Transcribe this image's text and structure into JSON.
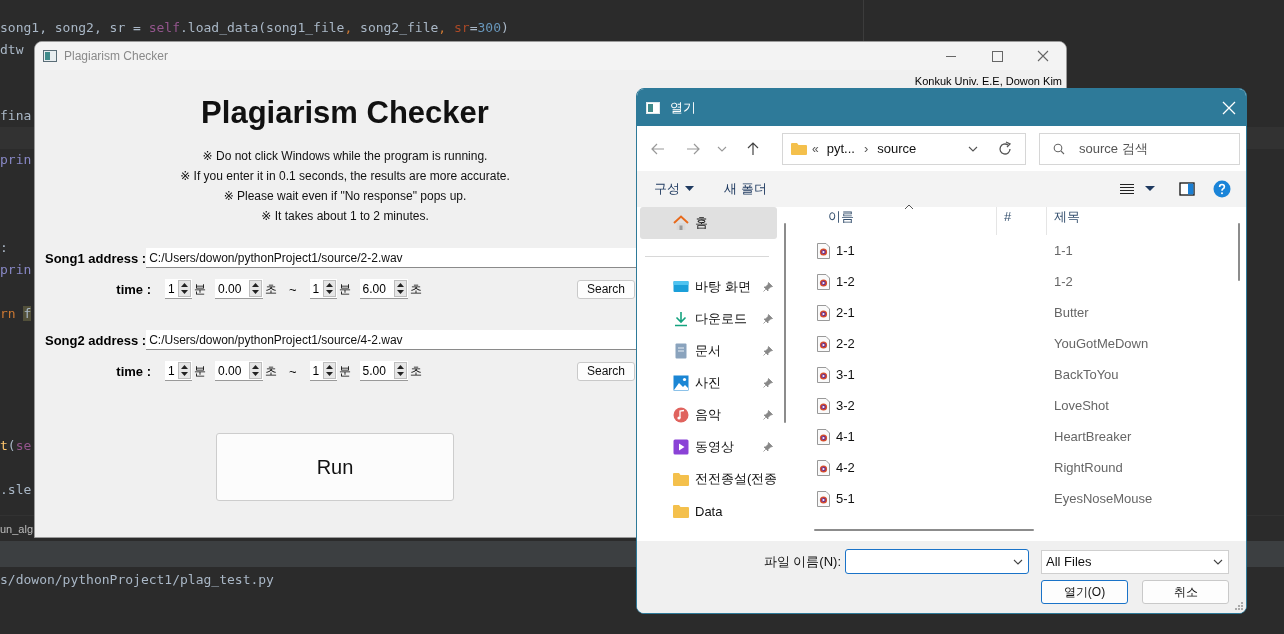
{
  "ide": {
    "code_lines": [
      {
        "tokens": [
          {
            "text": "song1, song2, sr = ",
            "kind": "plain"
          },
          {
            "text": "self",
            "kind": "self"
          },
          {
            "text": ".load_data(song1_file",
            "kind": "plain"
          },
          {
            "text": ", ",
            "kind": "punct"
          },
          {
            "text": "song2_file",
            "kind": "plain"
          },
          {
            "text": ", ",
            "kind": "punct"
          },
          {
            "text": "sr",
            "kind": "param"
          },
          {
            "text": "=",
            "kind": "plain"
          },
          {
            "text": "300",
            "kind": "number"
          },
          {
            "text": ")",
            "kind": "plain"
          }
        ]
      },
      {
        "tokens": [
          {
            "text": "dtw",
            "kind": "plain"
          }
        ]
      },
      {
        "tokens": [
          {
            "text": "fina",
            "kind": "plain"
          }
        ]
      },
      {
        "tokens": [
          {
            "text": "prin",
            "kind": "builtin"
          }
        ]
      },
      {
        "tokens": [
          {
            "text": ":",
            "kind": "plain"
          }
        ]
      },
      {
        "tokens": [
          {
            "text": "prin",
            "kind": "builtin"
          }
        ]
      },
      {
        "tokens": [
          {
            "text": "rn ",
            "kind": "keyword"
          },
          {
            "text": "f",
            "kind": "match"
          }
        ]
      },
      {
        "tokens": [
          {
            "text": "t",
            "kind": "function"
          },
          {
            "text": "(",
            "kind": "plain"
          },
          {
            "text": "se",
            "kind": "self"
          }
        ]
      },
      {
        "tokens": [
          {
            "text": ".sle",
            "kind": "plain"
          }
        ]
      }
    ],
    "current_line_highlight": true,
    "run_tab": "un_alg",
    "console_line": "s/dowon/pythonProject1/plag_test.py"
  },
  "app_window": {
    "title": "Plagiarism Checker",
    "credit": "Konkuk Univ. E.E, Dowon Kim",
    "heading": "Plagiarism Checker",
    "notes": [
      "※ Do not click Windows while the program is running.",
      "※ If you enter it in 0.1 seconds, the results are more accurate.",
      "※ Please wait even if \"No response\" pops up.",
      "※ It takes about 1 to 2 minutes."
    ],
    "songs": [
      {
        "label": "Song1 address :",
        "path": "C:/Users/dowon/pythonProject1/source/2-2.wav",
        "time_label": "time :",
        "start": [
          {
            "value": "1",
            "unit": "분"
          },
          {
            "value": "0.00",
            "unit": "초"
          }
        ],
        "separator": "~",
        "end": [
          {
            "value": "1",
            "unit": "분"
          },
          {
            "value": "6.00",
            "unit": "초"
          }
        ],
        "search_button": "Search"
      },
      {
        "label": "Song2 address :",
        "path": "C:/Users/dowon/pythonProject1/source/4-2.wav",
        "time_label": "time :",
        "start": [
          {
            "value": "1",
            "unit": "분"
          },
          {
            "value": "0.00",
            "unit": "초"
          }
        ],
        "separator": "~",
        "end": [
          {
            "value": "1",
            "unit": "분"
          },
          {
            "value": "5.00",
            "unit": "초"
          }
        ],
        "search_button": "Search"
      }
    ],
    "run_button": "Run"
  },
  "file_dialog": {
    "title": "열기",
    "address": {
      "overflow": "«",
      "parent": "pyt...",
      "separator": "›",
      "current": "source"
    },
    "search_placeholder": "source 검색",
    "organize": "구성",
    "new_folder": "새 폴더",
    "nav_items": [
      {
        "label": "홈",
        "kind": "home",
        "pinned": false,
        "selected": true
      },
      {
        "label": "바탕 화면",
        "kind": "desktop",
        "pinned": true,
        "selected": false
      },
      {
        "label": "다운로드",
        "kind": "download",
        "pinned": true,
        "selected": false
      },
      {
        "label": "문서",
        "kind": "document",
        "pinned": true,
        "selected": false
      },
      {
        "label": "사진",
        "kind": "picture",
        "pinned": true,
        "selected": false
      },
      {
        "label": "음악",
        "kind": "music",
        "pinned": true,
        "selected": false
      },
      {
        "label": "동영상",
        "kind": "video",
        "pinned": true,
        "selected": false
      },
      {
        "label": "전전종설(전종",
        "kind": "folder",
        "pinned": false,
        "selected": false
      },
      {
        "label": "Data",
        "kind": "folder",
        "pinned": false,
        "selected": false
      }
    ],
    "columns": [
      "이름",
      "#",
      "제목"
    ],
    "files": [
      {
        "name": "1-1",
        "title": "1-1"
      },
      {
        "name": "1-2",
        "title": "1-2"
      },
      {
        "name": "2-1",
        "title": "Butter"
      },
      {
        "name": "2-2",
        "title": "YouGotMeDown"
      },
      {
        "name": "3-1",
        "title": "BackToYou"
      },
      {
        "name": "3-2",
        "title": "LoveShot"
      },
      {
        "name": "4-1",
        "title": "HeartBreaker"
      },
      {
        "name": "4-2",
        "title": "RightRound"
      },
      {
        "name": "5-1",
        "title": "EyesNoseMouse"
      }
    ],
    "file_name_label": "파일 이름(N):",
    "file_type": "All Files",
    "buttons": [
      "열기(O)",
      "취소"
    ]
  }
}
